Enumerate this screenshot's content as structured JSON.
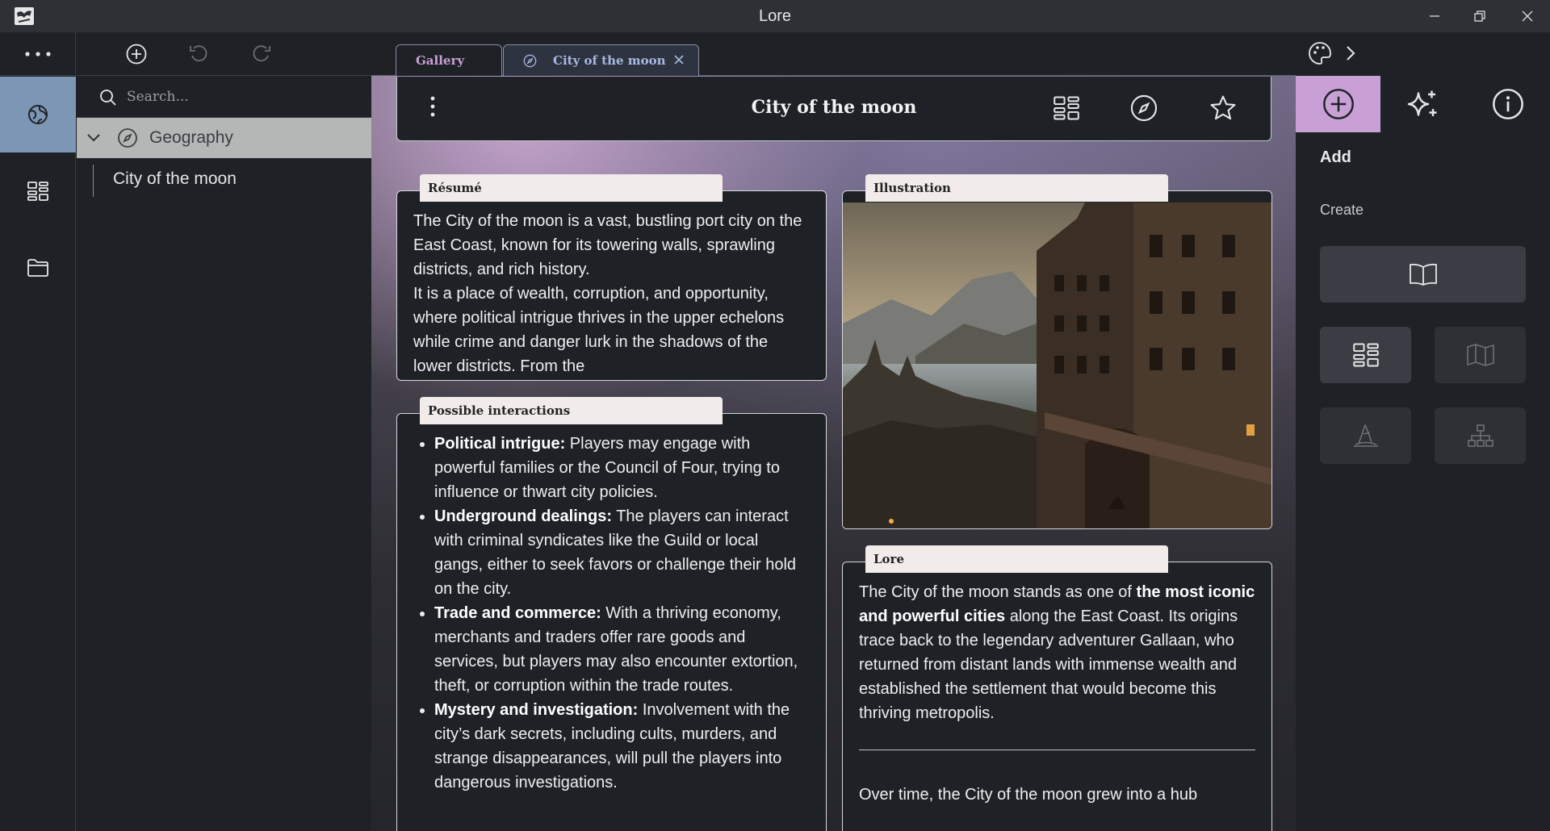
{
  "window": {
    "title": "Lore"
  },
  "sidebar": {
    "search_placeholder": "Search...",
    "tree": {
      "group_label": "Geography",
      "child_label": "City of the moon"
    }
  },
  "tabs": [
    {
      "label": "Gallery"
    },
    {
      "label": "City of the moon"
    }
  ],
  "document": {
    "title": "City of the moon"
  },
  "cards": {
    "resume": {
      "label": "Résumé",
      "paragraphs": [
        "The City of the moon is a vast, bustling port city on the East Coast, known for its towering walls, sprawling districts, and rich history.",
        "It is a place of wealth, corruption, and opportunity, where political intrigue thrives in the upper echelons while crime and danger lurk in the shadows of the lower districts. From the"
      ]
    },
    "interactions": {
      "label": "Possible interactions",
      "items": [
        {
          "title": "Political intrigue:",
          "text": " Players may engage with powerful families or the Council of Four, trying to influence or thwart city policies."
        },
        {
          "title": "Underground dealings:",
          "text": " The players can interact with criminal syndicates like the Guild or local gangs, either to seek favors or challenge their hold on the city."
        },
        {
          "title": "Trade and commerce:",
          "text": " With a thriving economy, merchants and traders offer rare goods and services, but players may also encounter extortion, theft, or corruption within the trade routes."
        },
        {
          "title": "Mystery and investigation:",
          "text": " Involvement with the city’s dark secrets, including cults, murders, and strange disappearances, will pull the players into dangerous investigations."
        }
      ]
    },
    "illustration": {
      "label": "Illustration"
    },
    "lore": {
      "label": "Lore",
      "p1_before": "The City of the moon stands as one of ",
      "p1_bold": "the most iconic and powerful cities",
      "p1_after": " along the East Coast. Its origins trace back to the legendary adventurer Gallaan, who returned from distant lands with immense wealth and established the settlement that would become this thriving metropolis.",
      "p2": "Over time, the City of the moon grew into a hub"
    }
  },
  "right_panel": {
    "heading": "Add",
    "subheading": "Create"
  },
  "colors": {
    "accent_purple": "#c9a0d6",
    "accent_blue": "#7d96b4",
    "background": "#1e2227"
  }
}
